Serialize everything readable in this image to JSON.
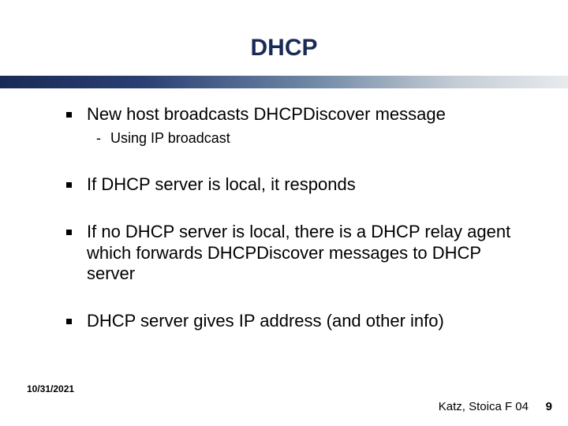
{
  "title": "DHCP",
  "bullets": [
    {
      "text": "New host broadcasts DHCPDiscover message",
      "sub": [
        "Using IP broadcast"
      ]
    },
    {
      "text": "If DHCP server is local, it responds"
    },
    {
      "text": "If no DHCP server is local, there is a DHCP relay agent which forwards DHCPDiscover messages to DHCP server"
    },
    {
      "text": "DHCP server gives IP address (and other info)"
    }
  ],
  "footer": {
    "date": "10/31/2021",
    "attribution": "Katz, Stoica F 04",
    "page": "9"
  }
}
